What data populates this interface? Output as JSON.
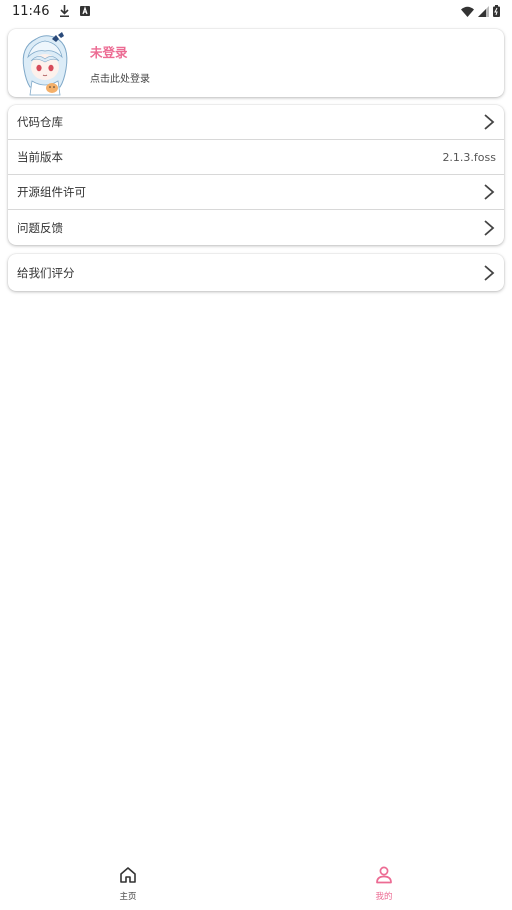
{
  "status_bar": {
    "time": "11:46"
  },
  "profile": {
    "name": "未登录",
    "hint": "点击此处登录"
  },
  "menu": {
    "items": [
      {
        "label": "代码仓库",
        "value": "",
        "has_chevron": true
      },
      {
        "label": "当前版本",
        "value": "2.1.3.foss",
        "has_chevron": false
      },
      {
        "label": "开源组件许可",
        "value": "",
        "has_chevron": true
      },
      {
        "label": "问题反馈",
        "value": "",
        "has_chevron": true
      }
    ],
    "rate": {
      "label": "给我们评分"
    }
  },
  "bottom_nav": {
    "items": [
      {
        "label": "主页",
        "icon": "home-icon",
        "active": false
      },
      {
        "label": "我的",
        "icon": "person-icon",
        "active": true
      }
    ]
  },
  "colors": {
    "accent": "#ec6b93",
    "text": "#333333"
  }
}
